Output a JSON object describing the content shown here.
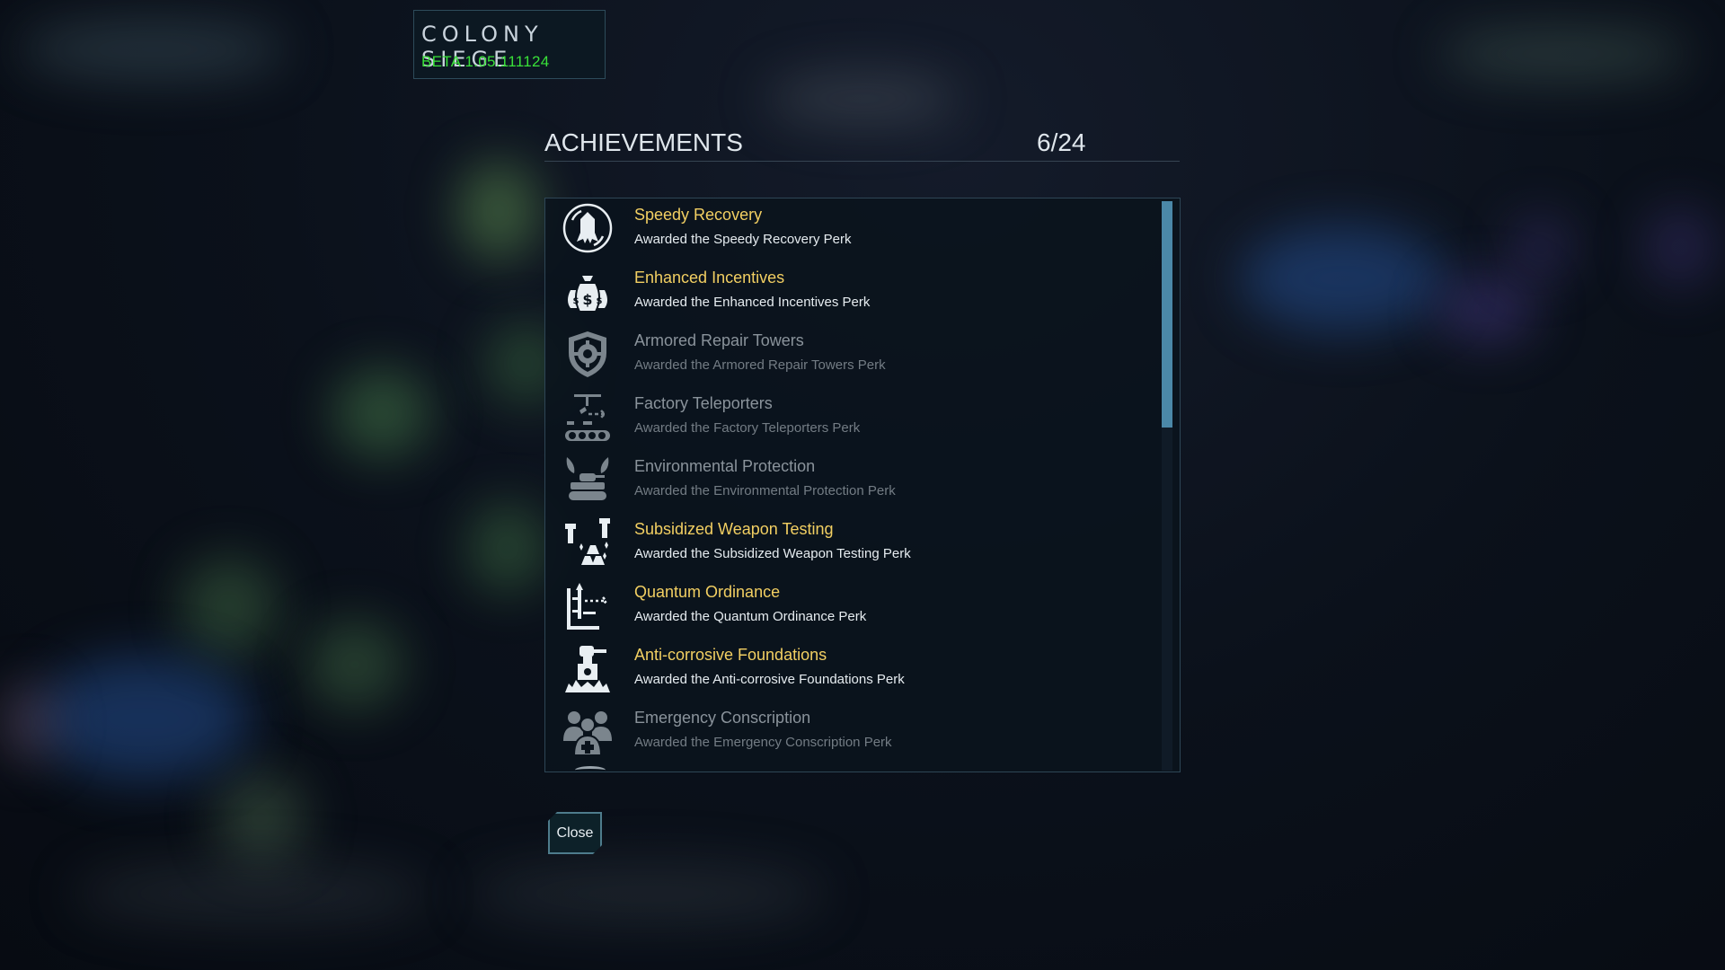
{
  "game": {
    "title": "COLONY SIEGE",
    "version": "BETA 1.05.111124"
  },
  "achievements": {
    "heading": "ACHIEVEMENTS",
    "count": "6/24",
    "items": [
      {
        "name": "Speedy Recovery",
        "desc": "Awarded the Speedy Recovery Perk",
        "unlocked": true,
        "icon": "speedy-recovery-icon"
      },
      {
        "name": "Enhanced Incentives",
        "desc": "Awarded the Enhanced Incentives Perk",
        "unlocked": true,
        "icon": "money-bags-icon"
      },
      {
        "name": "Armored Repair Towers",
        "desc": "Awarded the Armored Repair Towers Perk",
        "unlocked": false,
        "icon": "shield-wrench-icon"
      },
      {
        "name": "Factory Teleporters",
        "desc": "Awarded the Factory Teleporters Perk",
        "unlocked": false,
        "icon": "conveyor-icon"
      },
      {
        "name": "Environmental Protection",
        "desc": "Awarded the Environmental Protection Perk",
        "unlocked": false,
        "icon": "tank-leaves-icon"
      },
      {
        "name": "Subsidized Weapon Testing",
        "desc": "Awarded the Subsidized Weapon Testing Perk",
        "unlocked": true,
        "icon": "weapon-testing-icon"
      },
      {
        "name": "Quantum Ordinance",
        "desc": "Awarded the Quantum Ordinance Perk",
        "unlocked": true,
        "icon": "quantum-ordinance-icon"
      },
      {
        "name": "Anti-corrosive Foundations",
        "desc": "Awarded the Anti-corrosive Foundations Perk",
        "unlocked": true,
        "icon": "turret-foundation-icon"
      },
      {
        "name": "Emergency Conscription",
        "desc": "Awarded the Emergency Conscription Perk",
        "unlocked": false,
        "icon": "people-plus-icon"
      }
    ]
  },
  "close_label": "Close"
}
